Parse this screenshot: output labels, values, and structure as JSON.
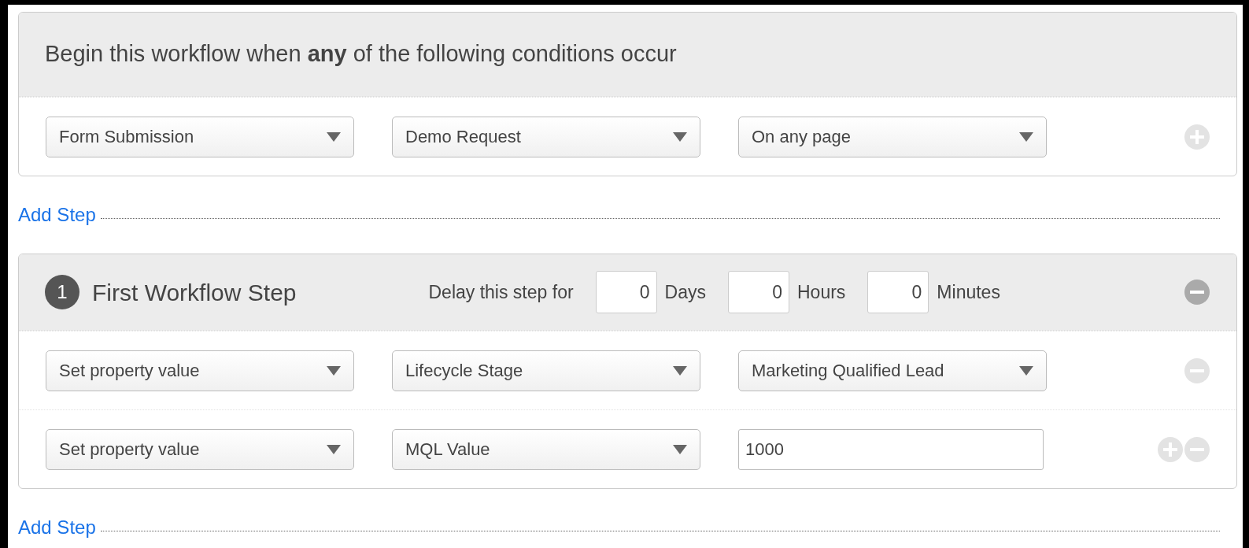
{
  "trigger": {
    "heading": "Begin this workflow when **any** of the following conditions occur",
    "rows": [
      {
        "fields": [
          {
            "kind": "select",
            "value": "Form Submission"
          },
          {
            "kind": "select",
            "value": "Demo Request"
          },
          {
            "kind": "select",
            "value": "On any page"
          }
        ],
        "buttons": [
          {
            "kind": "add",
            "disabled": true
          }
        ]
      }
    ]
  },
  "add_step_1": "Add Step",
  "step": {
    "number": "1",
    "title": "First Workflow Step",
    "delay_label": "Delay this step for",
    "delays": [
      {
        "value": "0",
        "unit": "Days"
      },
      {
        "value": "0",
        "unit": "Hours"
      },
      {
        "value": "0",
        "unit": "Minutes"
      }
    ],
    "header_buttons": [
      {
        "kind": "remove",
        "disabled": false
      }
    ],
    "rows": [
      {
        "fields": [
          {
            "kind": "select",
            "value": "Set property value"
          },
          {
            "kind": "select",
            "value": "Lifecycle Stage"
          },
          {
            "kind": "select",
            "value": "Marketing Qualified Lead"
          }
        ],
        "buttons": [
          {
            "kind": "remove",
            "disabled": true
          }
        ]
      },
      {
        "fields": [
          {
            "kind": "select",
            "value": "Set property value"
          },
          {
            "kind": "select",
            "value": "MQL Value"
          },
          {
            "kind": "input",
            "value": "1000"
          }
        ],
        "buttons": [
          {
            "kind": "add",
            "disabled": true
          },
          {
            "kind": "remove",
            "disabled": true
          }
        ]
      }
    ]
  },
  "add_step_2": "Add Step"
}
